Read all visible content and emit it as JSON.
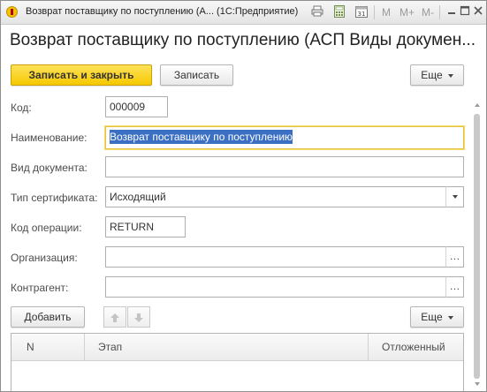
{
  "window": {
    "title": "Возврат поставщику по поступлению (А...  (1С:Предприятие)",
    "toolbar": {
      "m": "M",
      "m_plus": "M+",
      "m_minus": "M-"
    }
  },
  "form": {
    "title": "Возврат поставщику по поступлению (АСП Виды докумен...",
    "buttons": {
      "save_close": "Записать и закрыть",
      "save": "Записать",
      "more": "Еще"
    },
    "fields": {
      "code": {
        "label": "Код:",
        "value": "000009"
      },
      "name": {
        "label": "Наименование:",
        "value": "Возврат поставщику по поступлению"
      },
      "doc_type": {
        "label": "Вид документа:",
        "value": ""
      },
      "cert_type": {
        "label": "Тип сертификата:",
        "value": "Исходящий"
      },
      "op_code": {
        "label": "Код операции:",
        "value": "RETURN"
      },
      "organization": {
        "label": "Организация:",
        "value": ""
      },
      "counterparty": {
        "label": "Контрагент:",
        "value": ""
      }
    },
    "table": {
      "add_button": "Добавить",
      "more_button": "Еще",
      "columns": [
        "N",
        "Этап",
        "Отложенный"
      ]
    }
  },
  "colors": {
    "primary_button": "#f5c900",
    "selection": "#3a6fc3",
    "focus_border": "#e3c241"
  },
  "icons": {
    "app": "1c-icon",
    "print": "print-icon",
    "calculator": "calculator-icon",
    "calendar": "calendar-icon",
    "minimize": "minimize-icon",
    "maximize": "maximize-icon",
    "close": "close-icon",
    "move_up": "arrow-up-icon",
    "move_down": "arrow-down-icon"
  }
}
